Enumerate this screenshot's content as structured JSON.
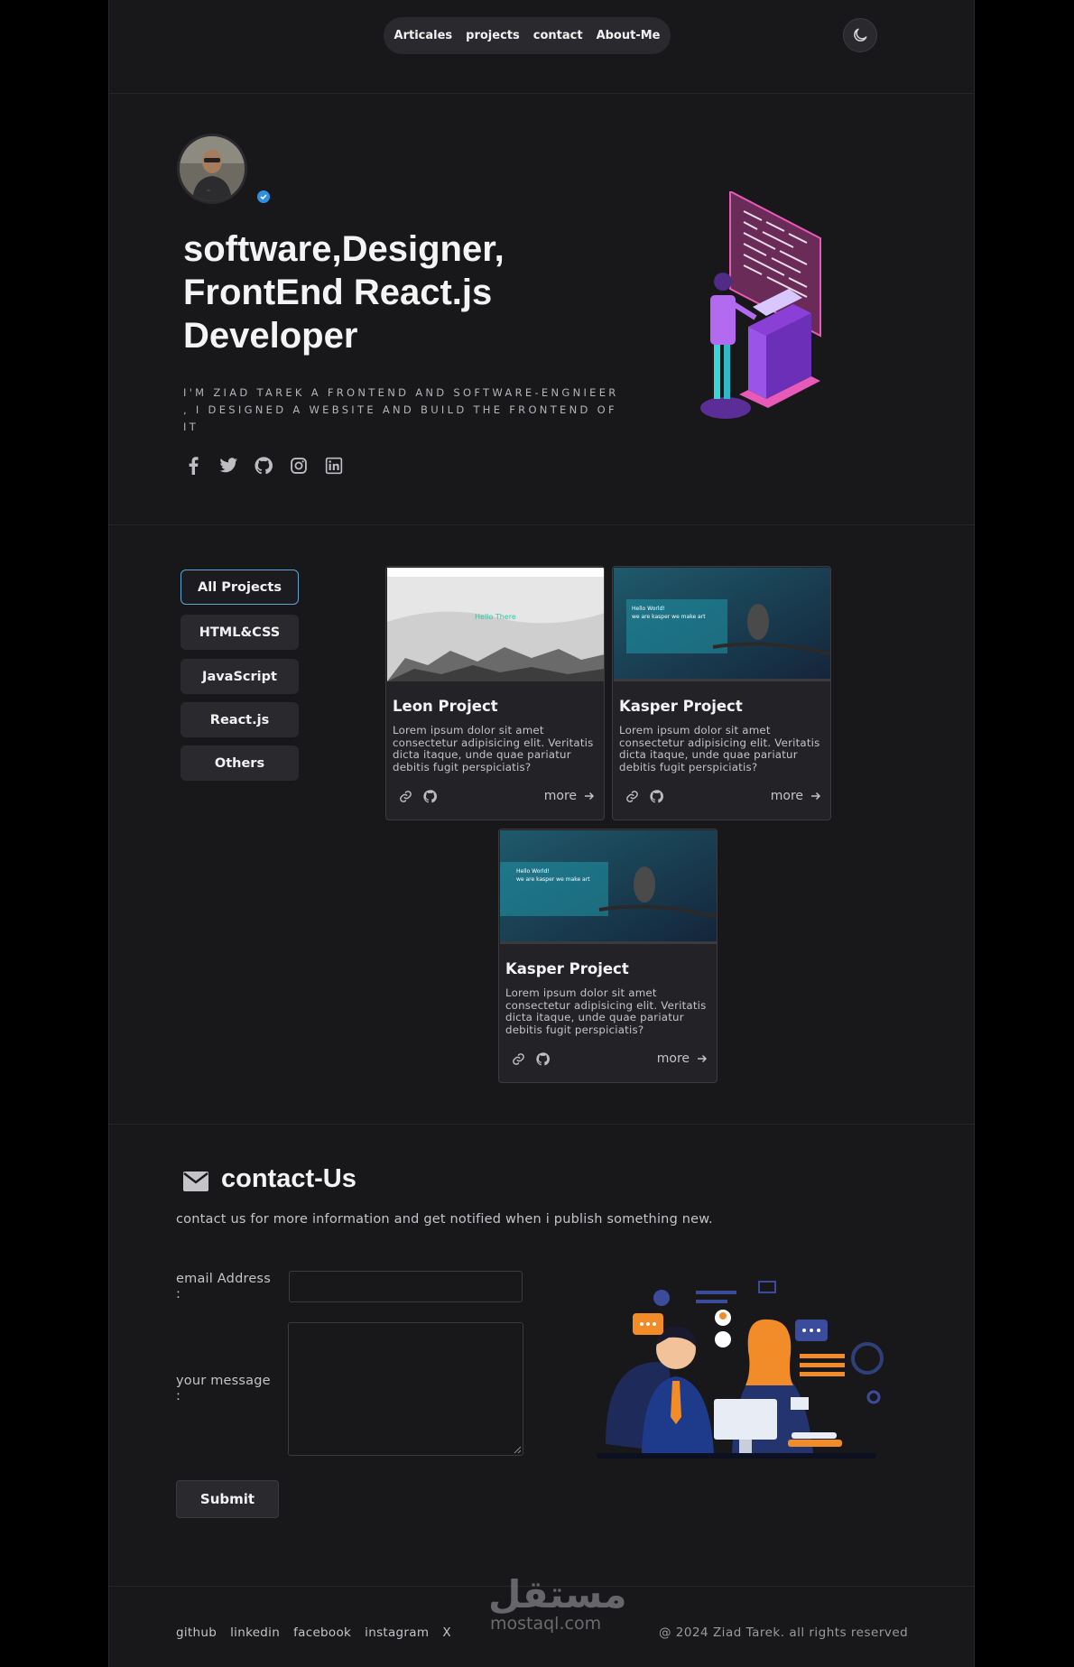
{
  "nav": {
    "items": [
      "Articales",
      "projects",
      "contact",
      "About-Me"
    ]
  },
  "hero": {
    "title": "software,Designer, FrontEnd React.js Developer",
    "subtitle": "I'M ZIAD TAREK A FRONTEND AND SOFTWARE-ENGNIEER , I DESIGNED A WEBSITE AND BUILD THE FRONTEND OF IT",
    "social_icons": [
      "facebook-icon",
      "twitter-icon",
      "github-icon",
      "instagram-icon",
      "linkedin-icon"
    ]
  },
  "filters": [
    "All Projects",
    "HTML&CSS",
    "JavaScript",
    "React.js",
    "Others"
  ],
  "projects": [
    {
      "title": "Leon Project",
      "description": "Lorem ipsum dolor sit amet consectetur adipisicing elit. Veritatis dicta itaque, unde quae pariatur debitis fugit perspiciatis?",
      "more": "more",
      "thumb_heading": "Hello There"
    },
    {
      "title": "Kasper Project",
      "description": "Lorem ipsum dolor sit amet consectetur adipisicing elit. Veritatis dicta itaque, unde quae pariatur debitis fugit perspiciatis?",
      "more": "more",
      "thumb_heading": "Hello World!",
      "thumb_sub": "we are kasper we make art"
    },
    {
      "title": "Kasper Project",
      "description": "Lorem ipsum dolor sit amet consectetur adipisicing elit. Veritatis dicta itaque, unde quae pariatur debitis fugit perspiciatis?",
      "more": "more",
      "thumb_heading": "Hello World!",
      "thumb_sub": "we are kasper we make art"
    }
  ],
  "contact": {
    "title": "contact-Us",
    "subtitle": "contact us for more information and get notified when i publish something new.",
    "email_label": "email Address :",
    "message_label": "your message :",
    "submit": "Submit"
  },
  "footer": {
    "links": [
      "github",
      "linkedin",
      "facebook",
      "instagram",
      "X"
    ],
    "copyright": "@ 2024 Ziad Tarek. all rights reserved",
    "watermark_ar": "مستقل",
    "watermark_en": "mostaql.com"
  },
  "colors": {
    "background": "#18181b",
    "surface": "#2a2a2e",
    "accent": "#5aa7d6"
  }
}
